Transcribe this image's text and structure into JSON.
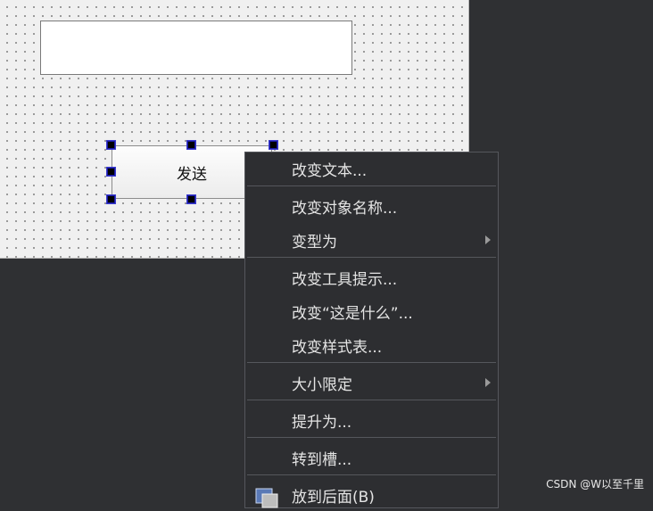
{
  "form": {
    "line_edit": {
      "value": ""
    },
    "push_button": {
      "label": "发送"
    }
  },
  "context_menu": {
    "items": [
      {
        "label": "改变文本...",
        "has_submenu": false
      },
      {
        "label": "改变对象名称...",
        "has_submenu": false
      },
      {
        "label": "变型为",
        "has_submenu": true
      },
      {
        "label": "改变工具提示...",
        "has_submenu": false
      },
      {
        "label": "改变“这是什么”...",
        "has_submenu": false
      },
      {
        "label": "改变样式表...",
        "has_submenu": false
      },
      {
        "label": "大小限定",
        "has_submenu": true
      },
      {
        "label": "提升为...",
        "has_submenu": false
      },
      {
        "label": "转到槽...",
        "has_submenu": false
      },
      {
        "label": "放到后面(B)",
        "has_submenu": false,
        "icon": "send-to-back-icon"
      }
    ]
  },
  "watermark": {
    "text": "CSDN @W以至千里"
  },
  "colors": {
    "canvas_bg": "#f0f0f0",
    "workspace_bg": "#2f3033",
    "menu_bg": "#2d2e31",
    "menu_text": "#e4e4e4",
    "selection_handle": "#000000",
    "selection_handle_border": "#1a1aa0"
  }
}
